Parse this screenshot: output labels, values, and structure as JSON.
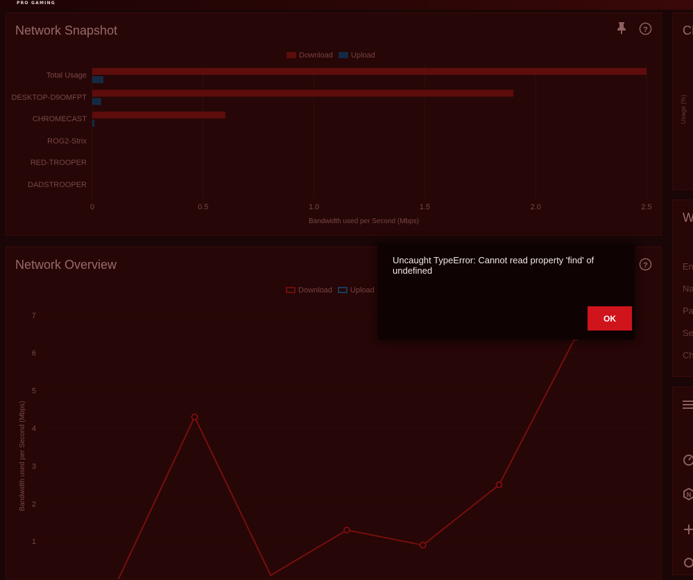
{
  "brand": "PRO GAMING",
  "snapshot": {
    "title": "Network Snapshot",
    "legend": {
      "download": "Download",
      "upload": "Upload"
    },
    "xlabel": "Bandwidth used per Second (Mbps)"
  },
  "overview": {
    "title": "Network Overview",
    "legend": {
      "download": "Download",
      "upload": "Upload"
    },
    "ylabel": "Bandwidth used per Second (Mbps)"
  },
  "right_panel": {
    "title_1": "CP",
    "usage_label": "Usage (%)",
    "title_2": "W",
    "rows": [
      "Ena",
      "Na",
      "Pa",
      "Sec",
      "Cha"
    ]
  },
  "dialog": {
    "message": "Uncaught TypeError: Cannot read property 'find' of undefined",
    "ok_label": "OK"
  },
  "chart_data": [
    {
      "type": "bar",
      "orientation": "horizontal",
      "categories": [
        "Total Usage",
        "DESKTOP-D9OMFPT",
        "CHROMECAST",
        "ROG2-Strix",
        "RED-TROOPER",
        "DADSTROOPER"
      ],
      "series": [
        {
          "name": "Download",
          "values": [
            2.5,
            1.9,
            0.6,
            0.0,
            0.0,
            0.0
          ],
          "color": "#5e0c0c"
        },
        {
          "name": "Upload",
          "values": [
            0.05,
            0.04,
            0.01,
            0.0,
            0.0,
            0.0
          ],
          "color": "#142a44"
        }
      ],
      "xticks": [
        0,
        0.5,
        1.0,
        1.5,
        2.0,
        2.5
      ],
      "xtick_labels": [
        "0",
        "0.5",
        "1.0",
        "1.5",
        "2.0",
        "2.5"
      ],
      "xlim": [
        0,
        2.5
      ],
      "xlabel": "Bandwidth used per Second (Mbps)",
      "legend": "top-center"
    },
    {
      "type": "line",
      "series": [
        {
          "name": "Download",
          "x": [
            0,
            1,
            2,
            3,
            4,
            5,
            6,
            7,
            8
          ],
          "values": [
            null,
            0.0,
            4.3,
            0.1,
            1.3,
            0.9,
            2.5,
            6.4,
            null
          ],
          "color": "#7a0e0e"
        }
      ],
      "yticks": [
        1,
        2,
        3,
        4,
        5,
        6,
        7
      ],
      "ylim": [
        0.6,
        7.4
      ],
      "ylabel": "Bandwidth used per Second (Mbps)",
      "legend": "top-center"
    }
  ]
}
